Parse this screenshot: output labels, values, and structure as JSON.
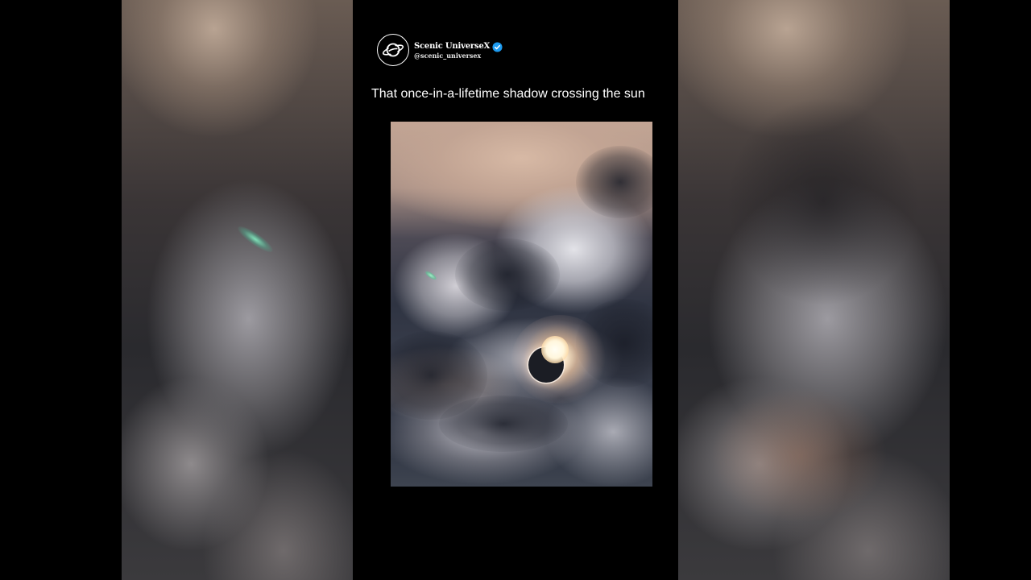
{
  "account": {
    "display_name": "Scenic UniverseX",
    "handle": "@scenic_universex",
    "verified": true,
    "avatar_icon": "saturn-planet-icon",
    "verified_icon": "verified-badge-icon"
  },
  "post": {
    "caption": "That once-in-a-lifetime shadow crossing the sun"
  },
  "colors": {
    "background": "#000000",
    "text": "#ffffff",
    "verified_badge": "#1d9bf0"
  }
}
